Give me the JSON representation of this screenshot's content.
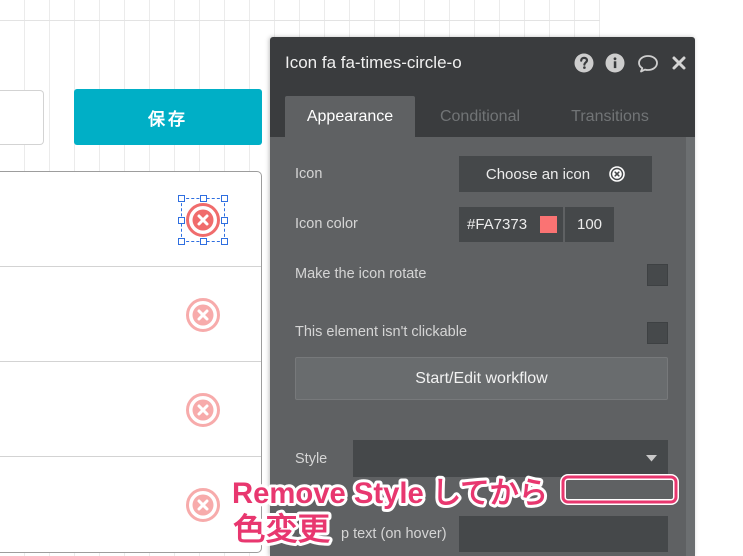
{
  "canvas": {
    "save_button": {
      "label": "保存"
    },
    "rows": [
      {
        "icon": "times-circle-o-icon",
        "selected": true
      },
      {
        "icon": "times-circle-o-icon",
        "selected": false
      },
      {
        "icon": "times-circle-o-icon",
        "selected": false
      },
      {
        "icon": "times-circle-o-icon",
        "selected": false
      }
    ]
  },
  "panel": {
    "title": "Icon fa fa-times-circle-o",
    "header_icons": [
      "question-circle-icon",
      "info-circle-icon",
      "comment-icon",
      "close-icon"
    ],
    "tabs": [
      {
        "label": "Appearance",
        "active": true
      },
      {
        "label": "Conditional",
        "active": false
      },
      {
        "label": "Transitions",
        "active": false
      }
    ],
    "icon": {
      "label": "Icon",
      "button_label": "Choose an icon",
      "button_icon": "times-circle-o-icon"
    },
    "icon_color": {
      "label": "Icon color",
      "value": "#FA7373",
      "opacity": "100"
    },
    "rotate": {
      "label": "Make the icon rotate",
      "checked": false
    },
    "not_clickable": {
      "label": "This element isn't clickable",
      "checked": false
    },
    "workflow_button": {
      "label": "Start/Edit workflow"
    },
    "style": {
      "label": "Style",
      "value": ""
    },
    "tooltip": {
      "label": "p text (on hover)",
      "value": ""
    }
  },
  "annotation": {
    "line1": "Remove Style してから",
    "line2": "色変更"
  },
  "colors": {
    "accent": "#00AFC6",
    "icon_selected": "#F06C6C",
    "icon_default": "#F7ABAB",
    "selection": "#2F6FE0",
    "annotation": "#E8376F",
    "panel_header": "#3A3C3E",
    "panel_body": "#5F6163"
  }
}
